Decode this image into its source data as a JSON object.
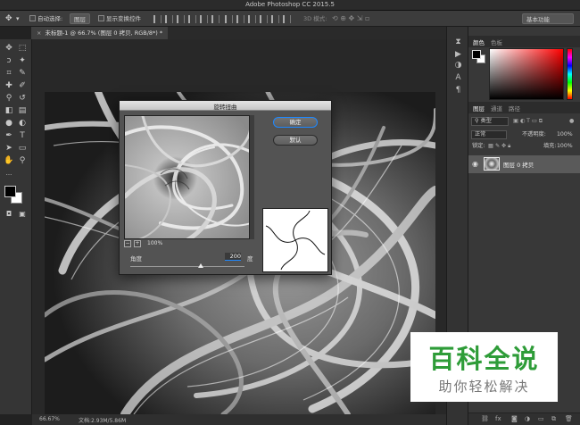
{
  "window": {
    "title": "Adobe Photoshop CC 2015.5"
  },
  "options_bar": {
    "auto_select_label": "自动选择:",
    "auto_select_target": "图层",
    "show_transform_label": "显示变换控件",
    "mode_3d_label": "3D 模式:",
    "workspace": "基本功能"
  },
  "document": {
    "tab_title": "未标题-1 @ 66.7% (图层 0 拷贝, RGB/8*) *",
    "zoom_status": "66.67%",
    "doc_size_status": "文档:2.93M/5.86M"
  },
  "colors": {
    "foreground": "#000000",
    "background": "#ffffff",
    "primary_button_border": "#1e88ff",
    "watermark_green": "#2e9c38"
  },
  "panels": {
    "color_tabs": [
      "颜色",
      "色板"
    ],
    "layers_tabs": [
      "图层",
      "通道",
      "路径"
    ],
    "filter_kind": "类型",
    "blend_mode": "正常",
    "opacity_label": "不透明度:",
    "opacity_value": "100%",
    "lock_label": "锁定:",
    "fill_label": "填充:",
    "fill_value": "100%",
    "layer_name": "图层 0 拷贝",
    "bottom_icons": [
      "link-icon",
      "fx-icon",
      "mask-icon",
      "adjustment-icon",
      "folder-icon",
      "new-layer-icon",
      "trash-icon"
    ]
  },
  "dialog": {
    "title": "旋转扭曲",
    "ok_label": "确定",
    "default_label": "默认",
    "zoom_value": "100%",
    "zoom_out_label": "−",
    "zoom_in_label": "+",
    "angle_label": "角度",
    "angle_value": "200",
    "angle_unit": "度"
  },
  "watermark": {
    "title": "百科全说",
    "subtitle": "助你轻松解决"
  }
}
